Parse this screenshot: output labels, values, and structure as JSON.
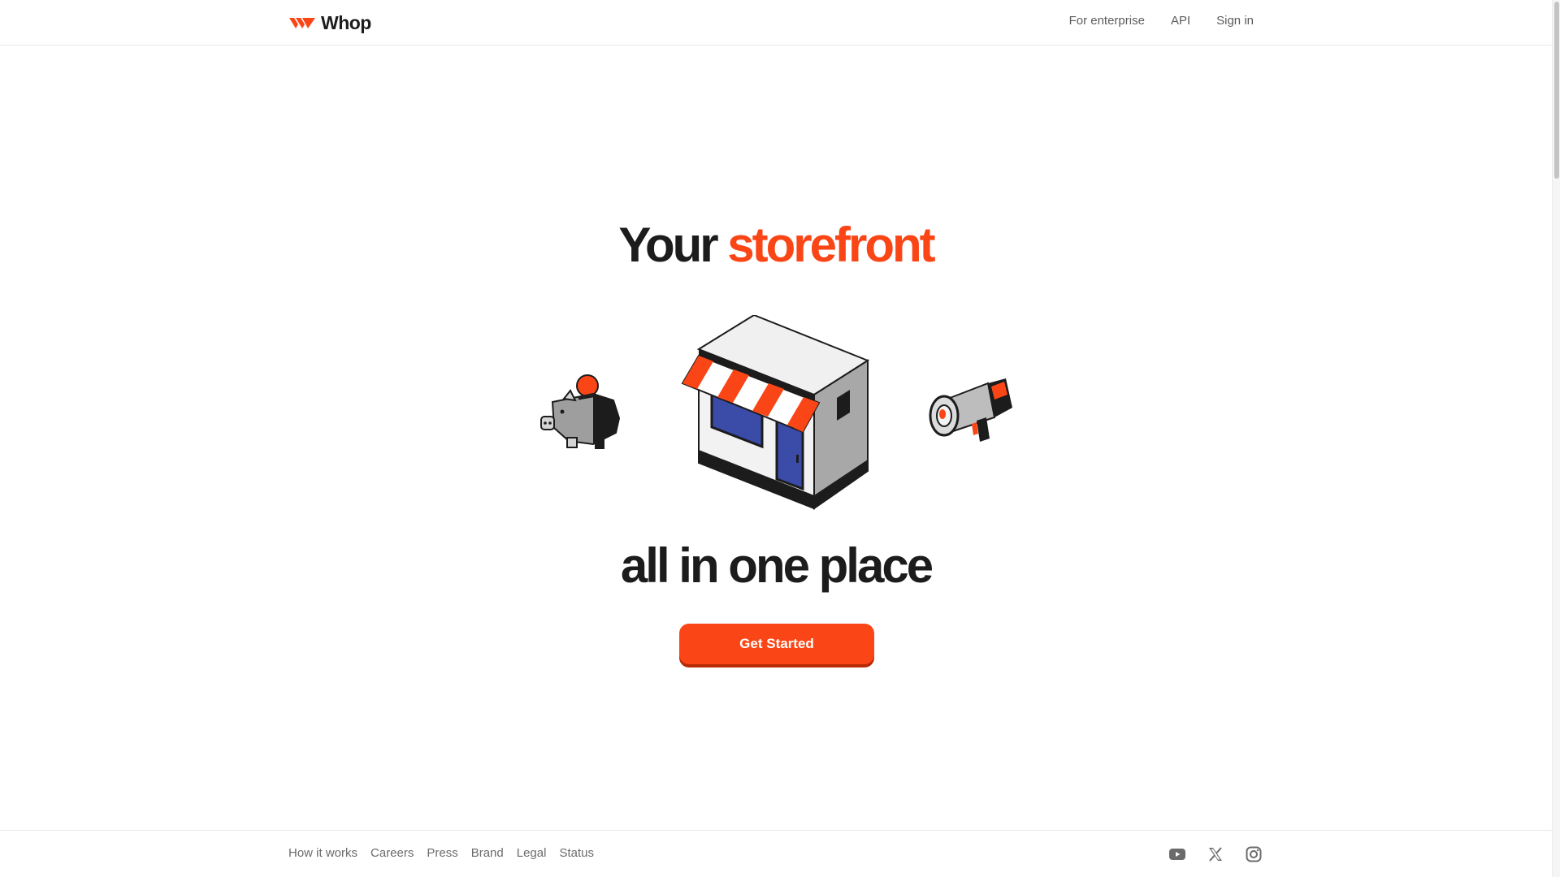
{
  "header": {
    "brand": "Whop",
    "nav": [
      {
        "label": "For enterprise"
      },
      {
        "label": "API"
      },
      {
        "label": "Sign in"
      }
    ]
  },
  "hero": {
    "title_prefix": "Your",
    "title_accent": "storefront",
    "subtitle": "all in one place",
    "cta_label": "Get Started",
    "illustrations": [
      "piggy-bank-icon",
      "storefront-icon",
      "megaphone-icon"
    ]
  },
  "footer": {
    "links": [
      {
        "label": "How it works"
      },
      {
        "label": "Careers"
      },
      {
        "label": "Press"
      },
      {
        "label": "Brand"
      },
      {
        "label": "Legal"
      },
      {
        "label": "Status"
      }
    ],
    "social": [
      "youtube-icon",
      "x-icon",
      "instagram-icon"
    ]
  },
  "colors": {
    "accent": "#fa4616",
    "text": "#1c1c1c",
    "muted": "#6b6b6b",
    "border": "#e8e8e8"
  }
}
